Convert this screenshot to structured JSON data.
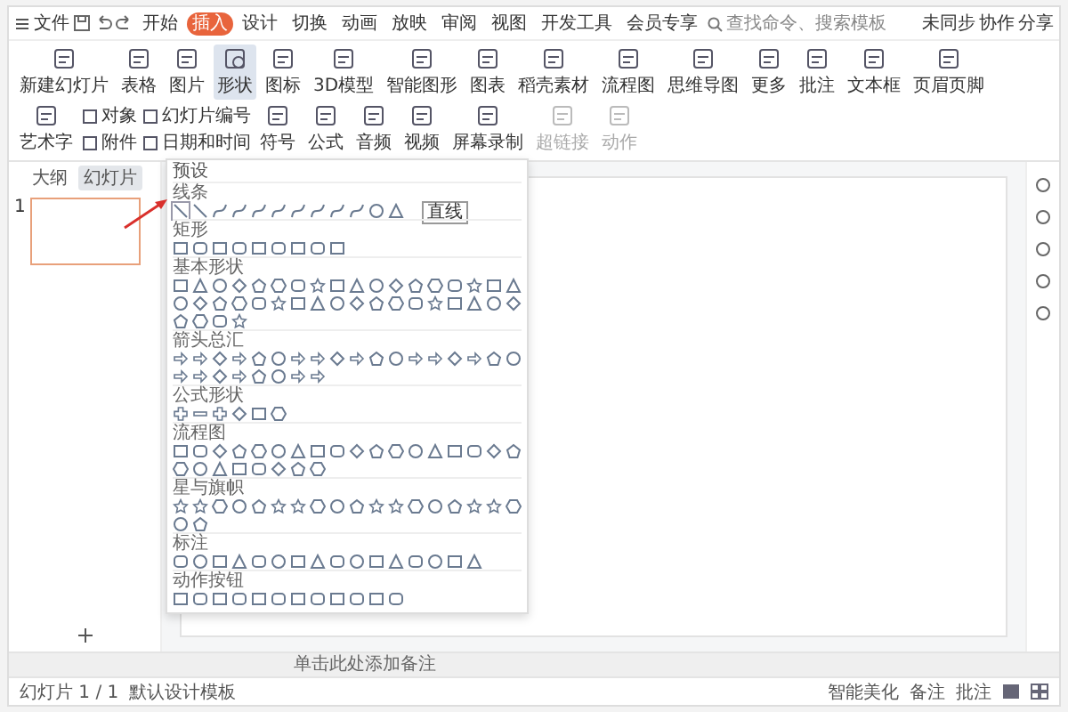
{
  "menu_bar": {
    "file_menu": "文件",
    "tabs": [
      {
        "label": "开始",
        "selected": false
      },
      {
        "label": "插入",
        "selected": true
      },
      {
        "label": "设计",
        "selected": false
      },
      {
        "label": "切换",
        "selected": false
      },
      {
        "label": "动画",
        "selected": false
      },
      {
        "label": "放映",
        "selected": false
      },
      {
        "label": "审阅",
        "selected": false
      },
      {
        "label": "视图",
        "selected": false
      },
      {
        "label": "开发工具",
        "selected": false
      },
      {
        "label": "会员专享",
        "selected": false
      }
    ],
    "search": {
      "placeholder": "查找命令、搜索模板"
    },
    "actions": [
      "未同步",
      "协作",
      "分享"
    ]
  },
  "ribbon": {
    "buttons": [
      {
        "label": "新建幻灯片",
        "kind": "large",
        "selected": false
      },
      {
        "label": "表格",
        "kind": "large",
        "selected": false
      },
      {
        "label": "图片",
        "kind": "large",
        "selected": false
      },
      {
        "label": "形状",
        "kind": "large",
        "selected": true
      },
      {
        "label": "图标",
        "kind": "large",
        "selected": false
      },
      {
        "label": "3D模型",
        "kind": "large",
        "selected": false
      },
      {
        "label": "智能图形",
        "kind": "large",
        "selected": false
      },
      {
        "label": "图表",
        "kind": "large",
        "selected": false
      },
      {
        "label": "稻壳素材",
        "kind": "large",
        "selected": false
      },
      {
        "label": "流程图",
        "kind": "large",
        "selected": false
      },
      {
        "label": "思维导图",
        "kind": "large",
        "selected": false
      },
      {
        "label": "更多",
        "kind": "large",
        "selected": false
      },
      {
        "label": "批注",
        "kind": "large",
        "selected": false
      },
      {
        "label": "文本框",
        "kind": "large",
        "selected": false
      },
      {
        "label": "页眉页脚",
        "kind": "large",
        "selected": false
      },
      {
        "label": "艺术字",
        "kind": "large",
        "selected": false
      },
      {
        "label": "对象",
        "kind": "small",
        "selected": false
      },
      {
        "label": "附件",
        "kind": "small",
        "selected": false
      },
      {
        "label": "幻灯片编号",
        "kind": "small",
        "selected": false
      },
      {
        "label": "日期和时间",
        "kind": "small",
        "selected": false
      },
      {
        "label": "符号",
        "kind": "large",
        "selected": false
      },
      {
        "label": "公式",
        "kind": "large",
        "selected": false
      },
      {
        "label": "音频",
        "kind": "large",
        "selected": false
      },
      {
        "label": "视频",
        "kind": "large",
        "selected": false
      },
      {
        "label": "屏幕录制",
        "kind": "large",
        "selected": false
      },
      {
        "label": "超链接",
        "kind": "large",
        "selected": false,
        "disabled": true
      },
      {
        "label": "动作",
        "kind": "large",
        "selected": false,
        "disabled": true
      }
    ]
  },
  "slide_panel": {
    "tabs": [
      {
        "label": "大纲",
        "selected": false
      },
      {
        "label": "幻灯片",
        "selected": true
      }
    ],
    "slides": [
      {
        "number": "1",
        "selected": true
      }
    ]
  },
  "shapes_menu": {
    "title": "预设",
    "tooltip": "直线",
    "sections": [
      "线条",
      "矩形",
      "基本形状",
      "箭头总汇",
      "公式形状",
      "流程图",
      "星与旗帜",
      "标注",
      "动作按钮"
    ]
  },
  "notes": {
    "placeholder": "单击此处添加备注"
  },
  "status_bar": {
    "slide_info": "幻灯片 1 / 1",
    "template": "默认设计模板",
    "actions": [
      "智能美化",
      "备注",
      "批注"
    ]
  }
}
